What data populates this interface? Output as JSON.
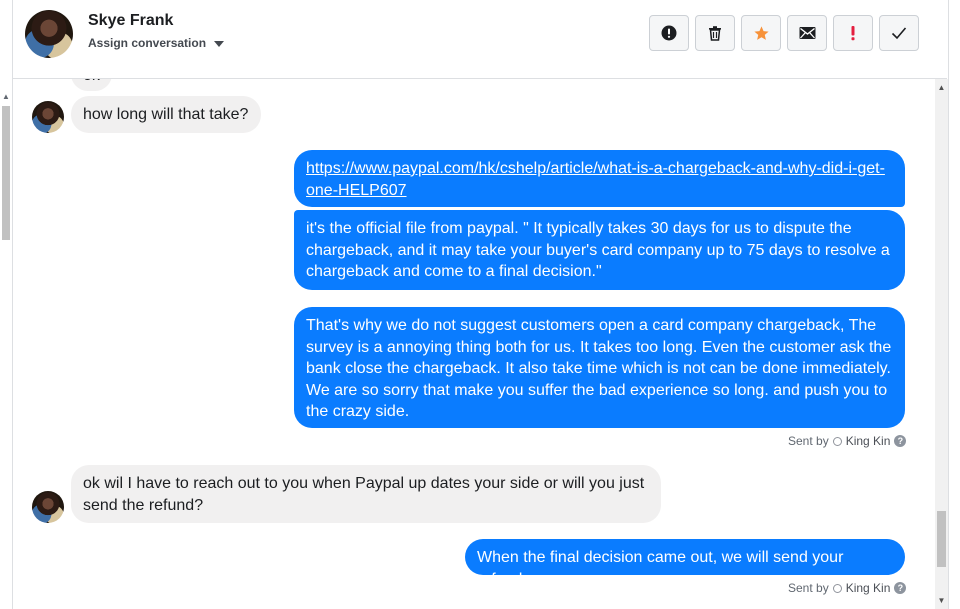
{
  "header": {
    "contact_name": "Skye Frank",
    "assign_label": "Assign conversation",
    "actions": [
      {
        "name": "spam-button",
        "icon": "exclamation-circle-icon"
      },
      {
        "name": "delete-button",
        "icon": "trash-icon"
      },
      {
        "name": "star-button",
        "icon": "star-icon",
        "color": "#f7923a"
      },
      {
        "name": "mark-unread-button",
        "icon": "envelope-icon"
      },
      {
        "name": "priority-button",
        "icon": "exclamation-icon",
        "color": "#e41e3f"
      },
      {
        "name": "mark-done-button",
        "icon": "check-icon"
      }
    ]
  },
  "messages": [
    {
      "from": "customer",
      "text": "ok"
    },
    {
      "from": "customer",
      "text": "how long will that take?"
    },
    {
      "from": "agent",
      "link": "https://www.paypal.com/hk/cshelp/article/what-is-a-chargeback-and-why-did-i-get-one-HELP607"
    },
    {
      "from": "agent",
      "text": "it's the official file from paypal. \" It typically takes 30 days for us to dispute the chargeback, and it may take your buyer's card company up to 75 days to resolve a chargeback and come to a final decision.\""
    },
    {
      "from": "agent",
      "text": "That's why we do not suggest customers open a card company chargeback, The survey is a annoying thing both for us. It takes too long. Even the customer ask the bank close the chargeback. It also take time which is not can be done immediately. We are so sorry that make you suffer the bad experience so long. and push you to the crazy side."
    },
    {
      "from": "customer",
      "text": "ok wil I have to reach out to you when Paypal up dates your side or will you just send the refund?"
    },
    {
      "from": "agent",
      "text": "When the final decision came out, we will send your refund."
    }
  ],
  "sent_by": {
    "prefix": "Sent by",
    "agent_name": "King Kin"
  },
  "colors": {
    "agent_bubble": "#0a7cff",
    "customer_bubble": "#f1f0f0"
  }
}
